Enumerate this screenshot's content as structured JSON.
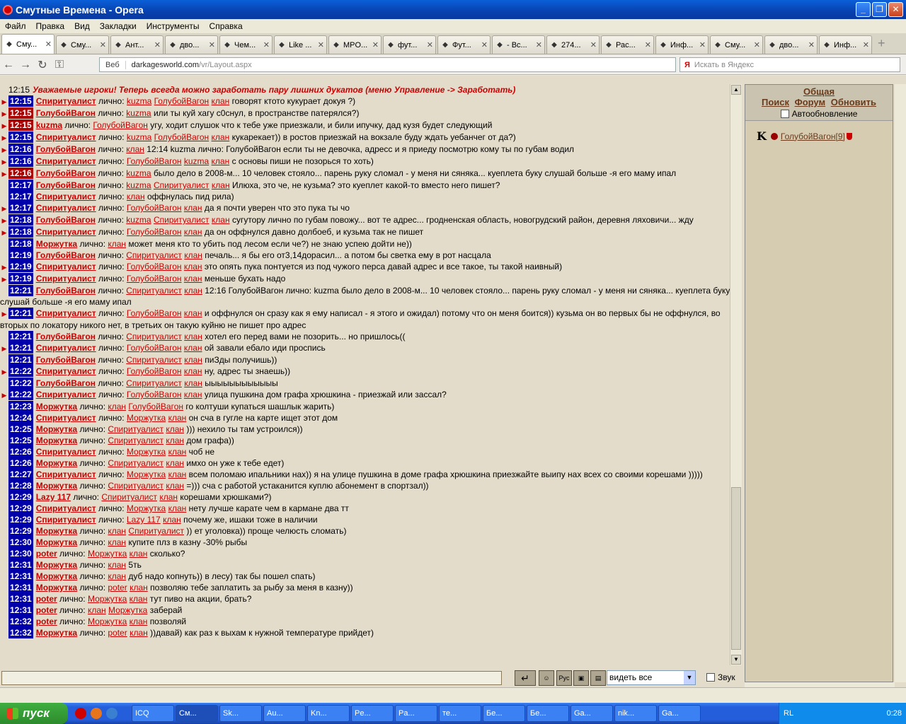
{
  "window": {
    "title": "Смутные Времена - Opera"
  },
  "menu": [
    "Файл",
    "Правка",
    "Вид",
    "Закладки",
    "Инструменты",
    "Справка"
  ],
  "tabs": [
    {
      "label": "Сму...",
      "active": true
    },
    {
      "label": "Сму...",
      "active": false
    },
    {
      "label": "Ант...",
      "active": false
    },
    {
      "label": "дво...",
      "active": false
    },
    {
      "label": "Чем...",
      "active": false
    },
    {
      "label": "Like ...",
      "active": false
    },
    {
      "label": "MPO...",
      "active": false
    },
    {
      "label": "фут...",
      "active": false
    },
    {
      "label": "Фут...",
      "active": false
    },
    {
      "label": "- Вс...",
      "active": false
    },
    {
      "label": "274...",
      "active": false
    },
    {
      "label": "Рас...",
      "active": false
    },
    {
      "label": "Инф...",
      "active": false
    },
    {
      "label": "Сму...",
      "active": false
    },
    {
      "label": "дво...",
      "active": false
    },
    {
      "label": "Инф...",
      "active": false
    }
  ],
  "address": {
    "web_label": "Веб",
    "host": "darkagesworld.com",
    "path": "/vr/Layout.aspx",
    "search_placeholder": "Искать в Яндекс"
  },
  "system_message": {
    "time": "12:15",
    "text": "Уважаемые игроки! Теперь всегда можно заработать пару лишних дукатов (меню Управление -> Заработать)"
  },
  "private_label": "лично:",
  "clan_label": "клан",
  "chat": [
    {
      "mark": true,
      "time": "12:15",
      "tc": "blue",
      "nick": "Спиритуалист",
      "targets": [
        "kuzma",
        "ГолубойВагон",
        "клан"
      ],
      "text": "говорят ктото кукурает докуя ?)"
    },
    {
      "mark": true,
      "time": "12:15",
      "tc": "red",
      "nick": "ГолубойВагон",
      "targets": [
        "kuzma"
      ],
      "text": "или ты куй хагу с0снул, в пространстве патерялся?)"
    },
    {
      "mark": true,
      "time": "12:15",
      "tc": "red",
      "nick": "kuzma",
      "targets": [
        "ГолубойВагон"
      ],
      "text": "угу, ходит слушок что к тебе уже приезжали, и били ипучку, дад кузя будет следующий"
    },
    {
      "mark": true,
      "time": "12:15",
      "tc": "blue",
      "nick": "Спиритуалист",
      "targets": [
        "kuzma",
        "ГолубойВагон",
        "клан"
      ],
      "text": "кукарекает)) в ростов приезжай на вокзале буду ждать уебанчег от да?)"
    },
    {
      "mark": true,
      "time": "12:16",
      "tc": "blue",
      "nick": "ГолубойВагон",
      "targets": [
        "клан"
      ],
      "text": "12:14 kuzma лично: ГолубойВагон если ты не девочка, адресс и я приеду посмотрю кому ты по губам водил"
    },
    {
      "mark": true,
      "time": "12:16",
      "tc": "blue",
      "nick": "Спиритуалист",
      "targets": [
        "ГолубойВагон",
        "kuzma",
        "клан"
      ],
      "text": "с основы пиши не позорься то хоть)"
    },
    {
      "mark": true,
      "time": "12:16",
      "tc": "red",
      "nick": "ГолубойВагон",
      "targets": [
        "kuzma"
      ],
      "text": "было дело в 2008-м... 10 человек стояло... парень руку сломал - у меня ни сяняка... куеплета буку слушай больше -я его маму ипал"
    },
    {
      "mark": false,
      "time": "12:17",
      "tc": "blue",
      "nick": "ГолубойВагон",
      "targets": [
        "kuzma",
        "Спиритуалист",
        "клан"
      ],
      "text": "Илюха, это че, не кузьма? это куеплет какой-то вместо него пишет?"
    },
    {
      "mark": false,
      "time": "12:17",
      "tc": "blue",
      "nick": "Спиритуалист",
      "targets": [
        "клан"
      ],
      "text": "оффнулась пид рила)"
    },
    {
      "mark": true,
      "time": "12:17",
      "tc": "blue",
      "nick": "Спиритуалист",
      "targets": [
        "ГолубойВагон",
        "клан"
      ],
      "text": "да я почти уверен что это пука ты чо"
    },
    {
      "mark": true,
      "time": "12:18",
      "tc": "blue",
      "nick": "ГолубойВагон",
      "targets": [
        "kuzma",
        "Спиритуалист",
        "клан"
      ],
      "text": "сугутору лично по губам повожу... вот те адрес... гродненская область, новогрудский район, деревня ляховичи... жду"
    },
    {
      "mark": true,
      "time": "12:18",
      "tc": "blue",
      "nick": "Спиритуалист",
      "targets": [
        "ГолубойВагон",
        "клан"
      ],
      "text": "да он оффнулся давно долбоеб, и кузьма так не пишет"
    },
    {
      "mark": false,
      "time": "12:18",
      "tc": "blue",
      "nick": "Моржутка",
      "targets": [
        "клан"
      ],
      "text": "может меня кто то убить под лесом если че?) не знаю успею дойти не))"
    },
    {
      "mark": false,
      "time": "12:19",
      "tc": "blue",
      "nick": "ГолубойВагон",
      "targets": [
        "Спиритуалист",
        "клан"
      ],
      "text": "печаль... я бы его от3,14дорасил... а потом бы светка ему в рот насцала"
    },
    {
      "mark": true,
      "time": "12:19",
      "tc": "blue",
      "nick": "Спиритуалист",
      "targets": [
        "ГолубойВагон",
        "клан"
      ],
      "text": "это опять пука понтуется из под чужого перса давай адрес и все такое, ты такой наивный)"
    },
    {
      "mark": true,
      "time": "12:19",
      "tc": "blue",
      "nick": "Спиритуалист",
      "targets": [
        "ГолубойВагон",
        "клан"
      ],
      "text": "меньше бухать надо"
    },
    {
      "mark": false,
      "time": "12:21",
      "tc": "blue",
      "nick": "ГолубойВагон",
      "targets": [
        "Спиритуалист",
        "клан"
      ],
      "text": "12:16 ГолубойВагон лично: kuzma было дело в 2008-м... 10 человек стояло... парень руку сломал - у меня ни сяняка... куеплета буку слушай больше -я его маму ипал"
    },
    {
      "mark": true,
      "time": "12:21",
      "tc": "blue",
      "nick": "Спиритуалист",
      "targets": [
        "ГолубойВагон",
        "клан"
      ],
      "text": "и оффнулся он сразу как я ему написал - я этого и ожидал) потому что он меня боится)) кузьма он во первых бы не оффнулся, во вторых по локатору никого нет, в третьих он такую куйню не пишет про адрес"
    },
    {
      "mark": false,
      "time": "12:21",
      "tc": "blue",
      "nick": "ГолубойВагон",
      "targets": [
        "Спиритуалист",
        "клан"
      ],
      "text": "хотел его перед вами не позорить... но пришлось(("
    },
    {
      "mark": true,
      "time": "12:21",
      "tc": "blue",
      "nick": "Спиритуалист",
      "targets": [
        "ГолубойВагон",
        "клан"
      ],
      "text": "ой завали ебало иди проспись"
    },
    {
      "mark": false,
      "time": "12:21",
      "tc": "blue",
      "nick": "ГолубойВагон",
      "targets": [
        "Спиритуалист",
        "клан"
      ],
      "text": "пиЗды получишь))"
    },
    {
      "mark": true,
      "time": "12:22",
      "tc": "blue",
      "nick": "Спиритуалист",
      "targets": [
        "ГолубойВагон",
        "клан"
      ],
      "text": "ну, адрес ты знаешь))"
    },
    {
      "mark": false,
      "time": "12:22",
      "tc": "blue",
      "nick": "ГолубойВагон",
      "targets": [
        "Спиритуалист",
        "клан"
      ],
      "text": "ыыыыыыыыыыыы"
    },
    {
      "mark": true,
      "time": "12:22",
      "tc": "blue",
      "nick": "Спиритуалист",
      "targets": [
        "ГолубойВагон",
        "клан"
      ],
      "text": "улица пушкина дом графа хрюшкина - приезжай или зассал?"
    },
    {
      "mark": false,
      "time": "12:23",
      "tc": "blue",
      "nick": "Моржутка",
      "targets": [
        "клан",
        "ГолубойВагон"
      ],
      "text": "го колтуши купаться шашлык жарить)"
    },
    {
      "mark": false,
      "time": "12:24",
      "tc": "blue",
      "nick": "Спиритуалист",
      "targets": [
        "Моржутка",
        "клан"
      ],
      "text": "он сча в гугле на карте ищет этот дом"
    },
    {
      "mark": false,
      "time": "12:25",
      "tc": "blue",
      "nick": "Моржутка",
      "targets": [
        "Спиритуалист",
        "клан"
      ],
      "text": "))) нехило ты там устроился))"
    },
    {
      "mark": false,
      "time": "12:25",
      "tc": "blue",
      "nick": "Моржутка",
      "targets": [
        "Спиритуалист",
        "клан"
      ],
      "text": "дом графа))"
    },
    {
      "mark": false,
      "time": "12:26",
      "tc": "blue",
      "nick": "Спиритуалист",
      "targets": [
        "Моржутка",
        "клан"
      ],
      "text": "чоб не"
    },
    {
      "mark": false,
      "time": "12:26",
      "tc": "blue",
      "nick": "Моржутка",
      "targets": [
        "Спиритуалист",
        "клан"
      ],
      "text": "имхо он уже к тебе едет)"
    },
    {
      "mark": false,
      "time": "12:27",
      "tc": "blue",
      "nick": "Спиритуалист",
      "targets": [
        "Моржутка",
        "клан"
      ],
      "text": "всем поломаю ипальники нах)) я на улице пушкина в доме графа хрюшкина приезжайте выипу нах всех со своими корешами )))))"
    },
    {
      "mark": false,
      "time": "12:28",
      "tc": "blue",
      "nick": "Моржутка",
      "targets": [
        "Спиритуалист",
        "клан"
      ],
      "text": "=))) сча с работой устаканится куплю абонемент в спортзал))"
    },
    {
      "mark": false,
      "time": "12:29",
      "tc": "blue",
      "nick": "Lazy 117",
      "targets": [
        "Спиритуалист",
        "клан"
      ],
      "text": "корешами хрюшками?)"
    },
    {
      "mark": false,
      "time": "12:29",
      "tc": "blue",
      "nick": "Спиритуалист",
      "targets": [
        "Моржутка",
        "клан"
      ],
      "text": "нету лучше карате чем в кармане два тт"
    },
    {
      "mark": false,
      "time": "12:29",
      "tc": "blue",
      "nick": "Спиритуалист",
      "targets": [
        "Lazy 117",
        "клан"
      ],
      "text": "почему же, ишаки тоже в наличии"
    },
    {
      "mark": false,
      "time": "12:29",
      "tc": "blue",
      "nick": "Моржутка",
      "targets": [
        "клан",
        "Спиритуалист"
      ],
      "text": ")) ет уголовка)) проще челюсть сломать)"
    },
    {
      "mark": false,
      "time": "12:30",
      "tc": "blue",
      "nick": "Моржутка",
      "targets": [
        "клан"
      ],
      "text": "купите плз в казну -30% рыбы"
    },
    {
      "mark": false,
      "time": "12:30",
      "tc": "blue",
      "nick": "poter",
      "targets": [
        "Моржутка",
        "клан"
      ],
      "text": "сколько?"
    },
    {
      "mark": false,
      "time": "12:31",
      "tc": "blue",
      "nick": "Моржутка",
      "targets": [
        "клан"
      ],
      "text": "5ть"
    },
    {
      "mark": false,
      "time": "12:31",
      "tc": "blue",
      "nick": "Моржутка",
      "targets": [
        "клан"
      ],
      "text": "дуб надо копнуть)) в лесу) так бы пошел спать)"
    },
    {
      "mark": false,
      "time": "12:31",
      "tc": "blue",
      "nick": "Моржутка",
      "targets": [
        "poter",
        "клан"
      ],
      "text": "позволяю тебе заплатить за рыбу за меня в казну))"
    },
    {
      "mark": false,
      "time": "12:31",
      "tc": "blue",
      "nick": "poter",
      "targets": [
        "Моржутка",
        "клан"
      ],
      "text": "тут пиво на акции, брать?"
    },
    {
      "mark": false,
      "time": "12:31",
      "tc": "blue",
      "nick": "poter",
      "targets": [
        "клан",
        "Моржутка"
      ],
      "text": "заберай"
    },
    {
      "mark": false,
      "time": "12:32",
      "tc": "blue",
      "nick": "poter",
      "targets": [
        "Моржутка",
        "клан"
      ],
      "text": "позволяй"
    },
    {
      "mark": false,
      "time": "12:32",
      "tc": "blue",
      "nick": "Моржутка",
      "targets": [
        "poter",
        "клан"
      ],
      "text": "))давай) как раз к выхам к нужной температуре прийдет)"
    }
  ],
  "panel": {
    "title": "Общая",
    "links": [
      "Поиск",
      "Форум",
      "Обновить"
    ],
    "auto_refresh": "Автообновление",
    "user": {
      "klan": "K",
      "name": "ГолубойВагон",
      "level": "[9]"
    }
  },
  "input_bar": {
    "button_translit": "Рус",
    "select_value": "видеть все",
    "sound_label": "Звук"
  },
  "taskbar": {
    "start": "пуск",
    "buttons": [
      "ICQ",
      "См...",
      "Sk...",
      "Au...",
      "Kn...",
      "Pe...",
      "Pa...",
      "те...",
      "Бе...",
      "Бе...",
      "Ga...",
      "nik...",
      "Ga..."
    ],
    "lang": "RL",
    "clock": "0:28"
  }
}
